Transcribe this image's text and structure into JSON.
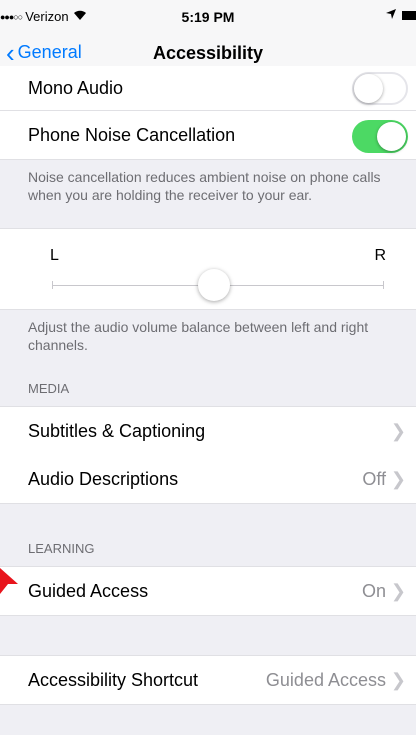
{
  "status": {
    "signal": "●●●○○",
    "carrier": "Verizon",
    "time": "5:19 PM"
  },
  "nav": {
    "back_label": "General",
    "title": "Accessibility"
  },
  "mono_audio": {
    "label": "Mono Audio",
    "on": false
  },
  "noise_cancellation": {
    "label": "Phone Noise Cancellation",
    "on": true
  },
  "noise_footer": "Noise cancellation reduces ambient noise on phone calls when you are holding the receiver to your ear.",
  "balance": {
    "left": "L",
    "right": "R",
    "position": 0.5
  },
  "balance_footer": "Adjust the audio volume balance between left and right channels.",
  "media_header": "MEDIA",
  "subtitles": {
    "label": "Subtitles & Captioning"
  },
  "audio_descriptions": {
    "label": "Audio Descriptions",
    "value": "Off"
  },
  "learning_header": "LEARNING",
  "guided_access": {
    "label": "Guided Access",
    "value": "On"
  },
  "shortcut": {
    "label": "Accessibility Shortcut",
    "value": "Guided Access"
  },
  "colors": {
    "accent": "#007aff",
    "toggle_on": "#4cd964",
    "arrow": "#e8141c"
  }
}
